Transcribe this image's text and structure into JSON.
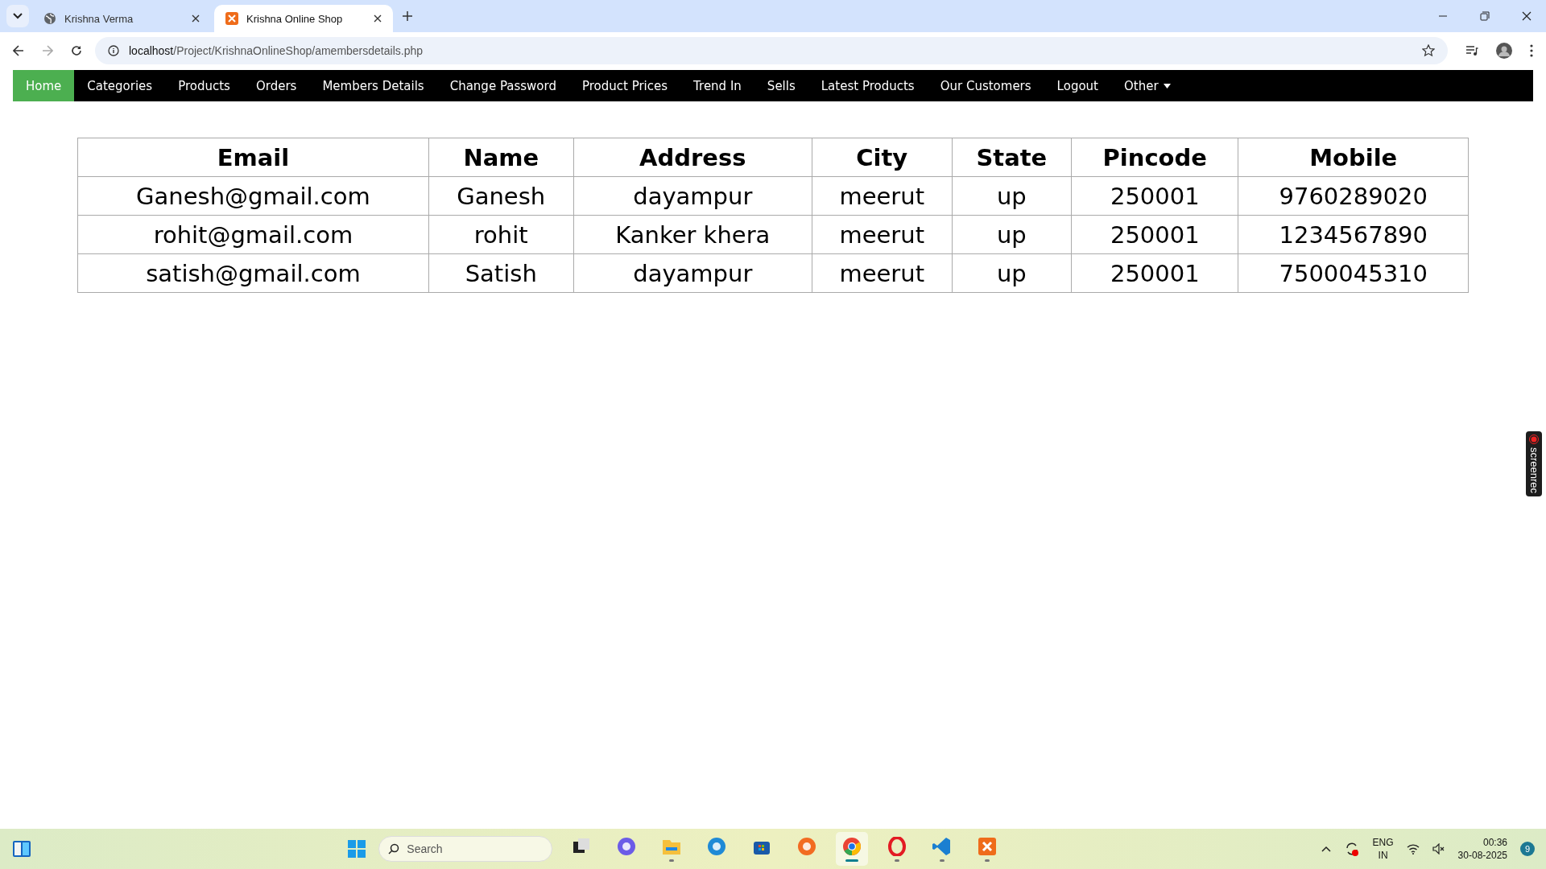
{
  "browser": {
    "tabs": [
      {
        "title": "Krishna Verma",
        "kind": "globe",
        "selected": false
      },
      {
        "title": "Krishna Online Shop",
        "kind": "xampp",
        "selected": true
      }
    ],
    "url": "localhost/Project/KrishnaOnlineShop/amembersdetails.php"
  },
  "nav": [
    {
      "label": "Home",
      "selected": true
    },
    {
      "label": "Categories",
      "selected": false
    },
    {
      "label": "Products",
      "selected": false
    },
    {
      "label": "Orders",
      "selected": false
    },
    {
      "label": "Members Details",
      "selected": false
    },
    {
      "label": "Change Password",
      "selected": false
    },
    {
      "label": "Product Prices",
      "selected": false
    },
    {
      "label": "Trend In",
      "selected": false
    },
    {
      "label": "Sells",
      "selected": false
    },
    {
      "label": "Latest Products",
      "selected": false
    },
    {
      "label": "Our Customers",
      "selected": false
    },
    {
      "label": "Logout",
      "selected": false
    },
    {
      "label": "Other",
      "selected": false,
      "dropdown": true
    }
  ],
  "table": {
    "columns": [
      "Email",
      "Name",
      "Address",
      "City",
      "State",
      "Pincode",
      "Mobile"
    ],
    "rows": [
      [
        "Ganesh@gmail.com",
        "Ganesh",
        "dayampur",
        "meerut",
        "up",
        "250001",
        "9760289020"
      ],
      [
        "rohit@gmail.com",
        "rohit",
        "Kanker khera",
        "meerut",
        "up",
        "250001",
        "1234567890"
      ],
      [
        "satish@gmail.com",
        "Satish",
        "dayampur",
        "meerut",
        "up",
        "250001",
        "7500045310"
      ]
    ]
  },
  "recorder": {
    "label": "screenrec"
  },
  "taskbar": {
    "search_placeholder": "Search",
    "apps": [
      {
        "kind": "taskview",
        "running": false,
        "selected": false
      },
      {
        "kind": "meet",
        "running": false,
        "selected": false
      },
      {
        "kind": "folder",
        "running": true,
        "selected": false
      },
      {
        "kind": "edge",
        "running": false,
        "selected": false
      },
      {
        "kind": "store",
        "running": false,
        "selected": false
      },
      {
        "kind": "firefox",
        "running": false,
        "selected": false
      },
      {
        "kind": "chrome",
        "running": true,
        "selected": true
      },
      {
        "kind": "opera",
        "running": true,
        "selected": false
      },
      {
        "kind": "vscode",
        "running": true,
        "selected": false
      },
      {
        "kind": "xampp",
        "running": true,
        "selected": false
      }
    ],
    "language": "ENG",
    "region": "IN",
    "time": "00:36",
    "date": "30-08-2025",
    "notifications": "9"
  }
}
